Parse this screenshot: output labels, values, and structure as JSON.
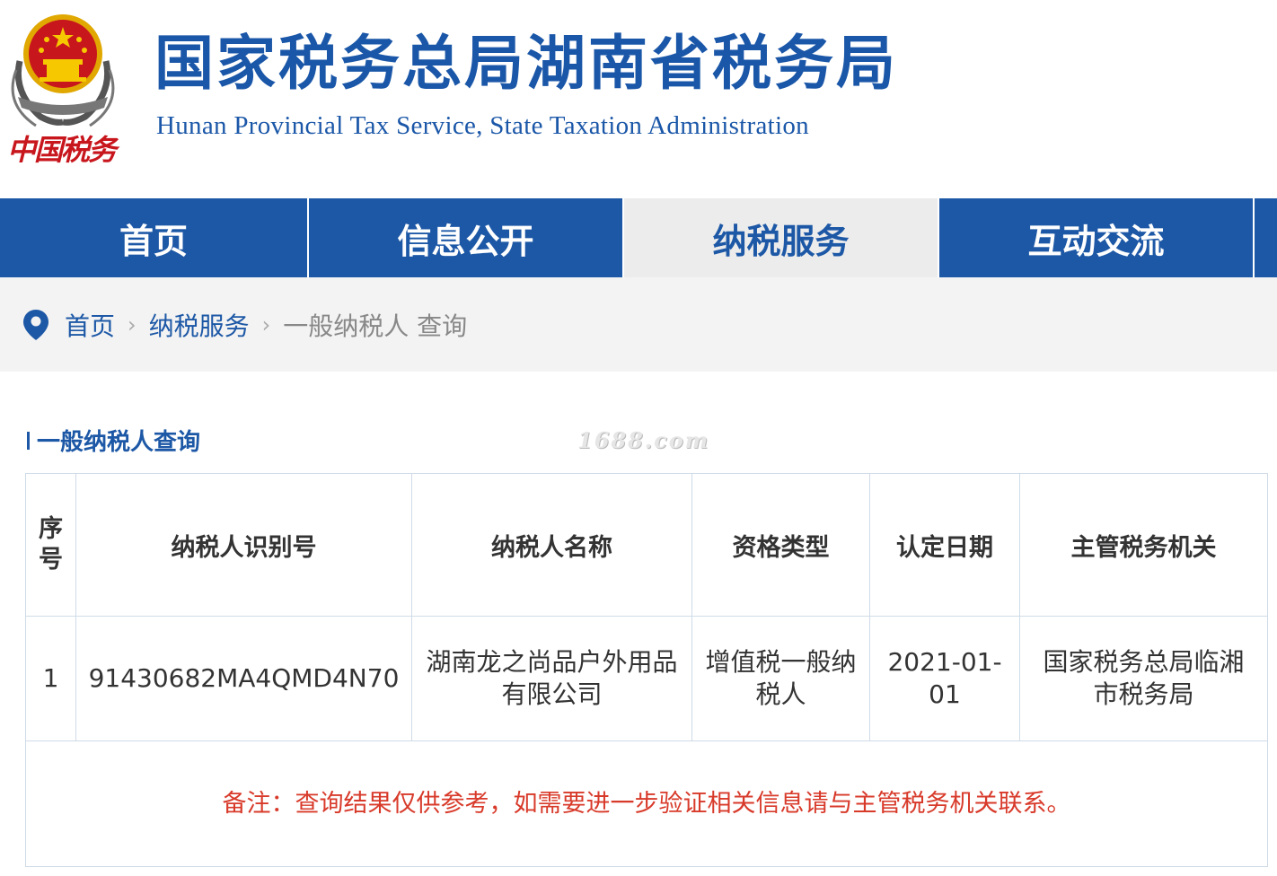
{
  "header": {
    "title": "国家税务总局湖南省税务局",
    "subtitle": "Hunan Provincial  Tax Service,  State Taxation Administration",
    "emblem_text": "中国税务"
  },
  "nav": {
    "items": [
      {
        "label": "首页"
      },
      {
        "label": "信息公开"
      },
      {
        "label": "纳税服务"
      },
      {
        "label": "互动交流"
      }
    ],
    "active_index": 2
  },
  "breadcrumb": {
    "items": [
      "首页",
      "纳税服务",
      "一般纳税人 查询"
    ]
  },
  "section": {
    "title": "一般纳税人查询"
  },
  "watermark": "1688.com",
  "table": {
    "headers": [
      "序号",
      "纳税人识别号",
      "纳税人名称",
      "资格类型",
      "认定日期",
      "主管税务机关"
    ],
    "rows": [
      [
        "1",
        "91430682MA4QMD4N70",
        "湖南龙之尚品户外用品有限公司",
        "增值税一般纳税人",
        "2021-01-01",
        "国家税务总局临湘市税务局"
      ]
    ],
    "note": "备注：查询结果仅供参考，如需要进一步验证相关信息请与主管税务机关联系。"
  },
  "colors": {
    "brand_blue": "#1d58a6",
    "note_red": "#d83a2a",
    "emblem_red": "#c8161d",
    "emblem_gold": "#f0b400"
  }
}
